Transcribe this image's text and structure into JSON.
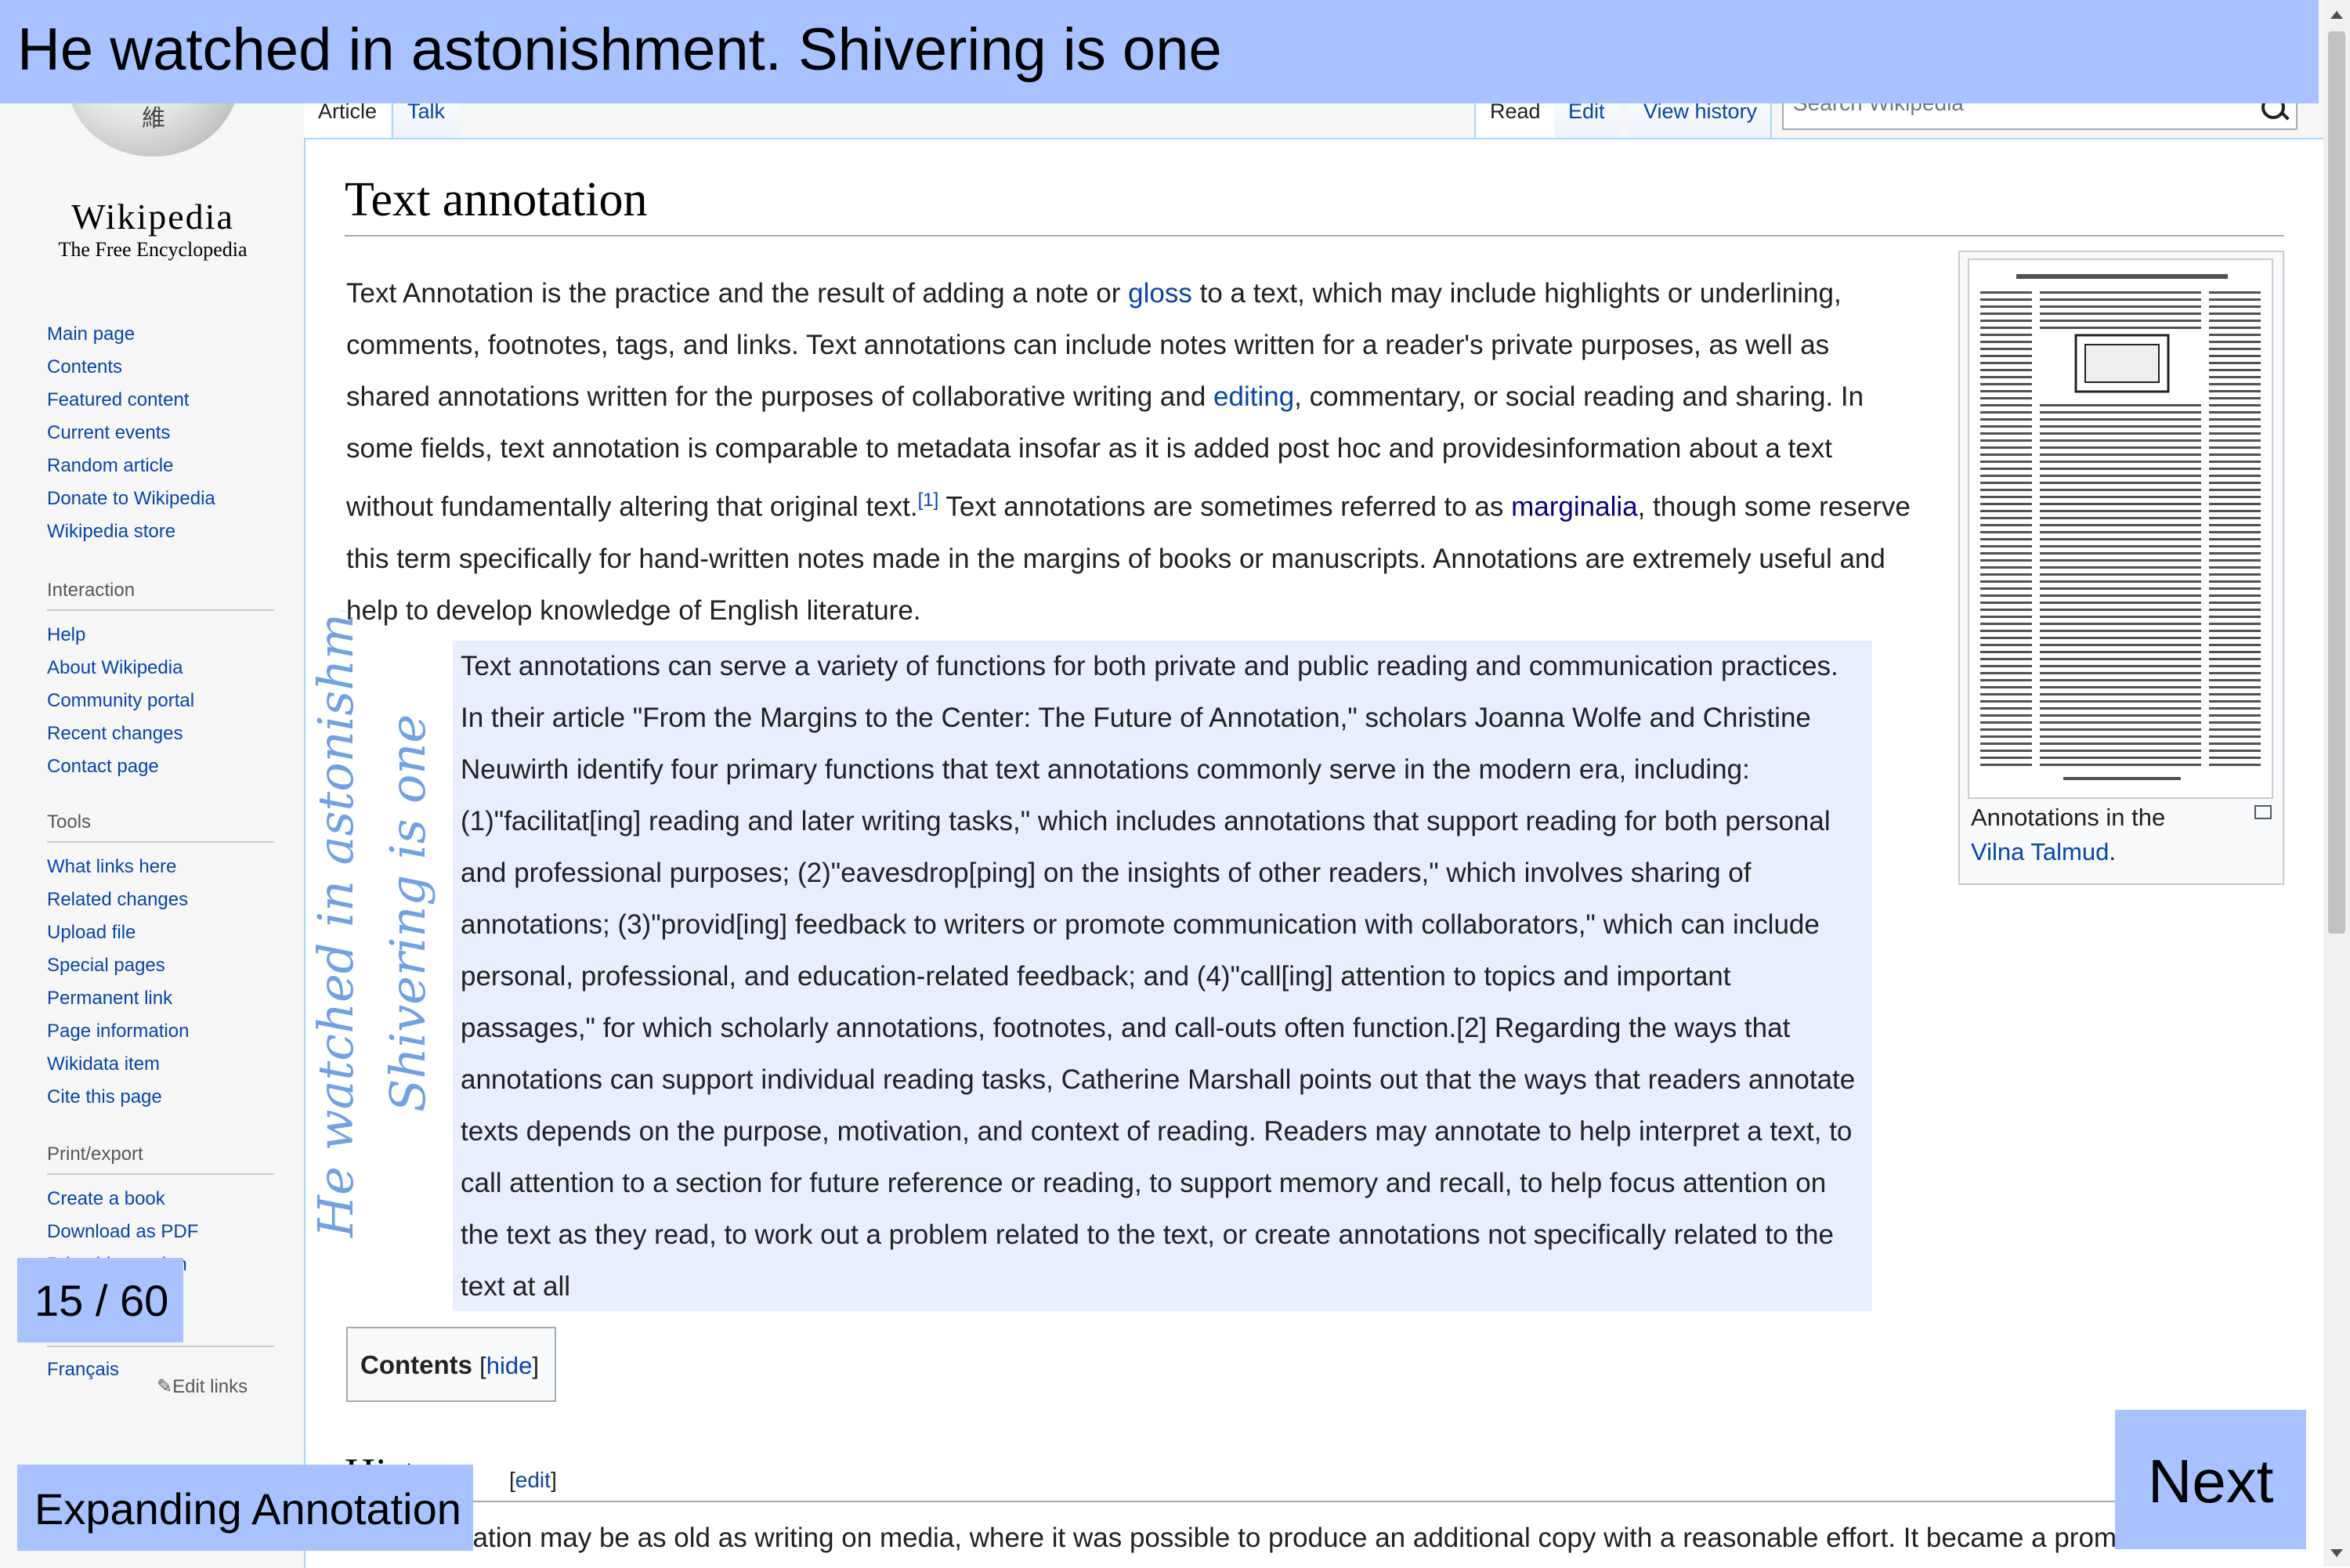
{
  "sidebar": {
    "wordmark": "Wikipedia",
    "tagline": "The Free Encyclopedia",
    "main_nav": [
      "Main page",
      "Contents",
      "Featured content",
      "Current events",
      "Random article",
      "Donate to Wikipedia",
      "Wikipedia store"
    ],
    "interaction": {
      "heading": "Interaction",
      "items": [
        "Help",
        "About Wikipedia",
        "Community portal",
        "Recent changes",
        "Contact page"
      ]
    },
    "tools": {
      "heading": "Tools",
      "items": [
        "What links here",
        "Related changes",
        "Upload file",
        "Special pages",
        "Permanent link",
        "Page information",
        "Wikidata item",
        "Cite this page"
      ]
    },
    "print": {
      "heading": "Print/export",
      "items": [
        "Create a book",
        "Download as PDF",
        "Printable version"
      ]
    },
    "languages": {
      "items": [
        "Français"
      ]
    },
    "edit_links": "Edit links"
  },
  "tabs": {
    "article": "Article",
    "talk": "Talk",
    "read": "Read",
    "edit": "Edit",
    "view_history": "View history"
  },
  "search": {
    "placeholder": "Search Wikipedia"
  },
  "article": {
    "title": "Text annotation",
    "p1_a": "Text Annotation is the practice and the result of adding a note or ",
    "link_gloss": "gloss",
    "p1_b": " to a text, which may include highlights or underlining, comments, footnotes, tags, and links. Text annotations can include notes written for a reader's private purposes, as well as shared annotations written for the purposes of collaborative writing and ",
    "link_editing": "editing",
    "p1_c": ", commentary, or social reading and sharing. In some fields, text annotation is comparable to metadata insofar as it is added post hoc and providesinformation about a text without fundamentally altering that original text.",
    "ref1": "[1]",
    "p1_d": " Text annotations are sometimes referred to as ",
    "link_marginalia": "marginalia",
    "p1_e": ", though some reserve this term specifically for hand-written notes made in the margins of books or manuscripts. Annotations are extremely useful and help to develop knowledge of English literature.",
    "quote": "Text annotations can serve a variety of functions for both private and public reading and communication practices. In their article \"From the Margins to the Center: The Future of Annotation,\" scholars Joanna Wolfe and Christine Neuwirth identify four primary functions that text annotations commonly serve in the modern era, including: (1)\"facilitat[ing] reading and later writing tasks,\" which includes annotations that support reading for both personal and professional purposes; (2)\"eavesdrop[ping] on the insights of other readers,\" which involves sharing of annotations; (3)\"provid[ing] feedback to writers or promote communication with collaborators,\" which can include personal, professional, and education-related feedback; and (4)\"call[ing] attention to topics and important passages,\" for which scholarly annotations, footnotes, and call-outs often function.[2] Regarding the ways that annotations can support individual reading tasks, Catherine Marshall points out that the ways that readers annotate texts depends on the purpose, motivation, and context of reading. Readers may annotate to help interpret a text, to call attention to a section for future reference or reading, to support memory and recall, to help focus attention on the text as they read, to work out a problem related to the text, or create annotations not specifically related to the text at all",
    "thumb_caption_a": "Annotations in the ",
    "thumb_caption_link": "Vilna Talmud",
    "thumb_caption_b": ".",
    "toc_title": "Contents",
    "toc_hide": "hide",
    "history_heading": "History",
    "history_edit": "edit",
    "history_text": "Text annotation may be as old as writing on media, where it was possible to produce an additional copy with a reasonable effort. It became a prominent"
  },
  "overlay": {
    "top_text": "He watched in astonishment. Shivering is one",
    "counter": "15 / 60",
    "mode": "Expanding Annotation",
    "next": "Next",
    "handwriting_lines": [
      "He watched in astonishment",
      "Shivering is one"
    ]
  },
  "colors": {
    "overlay": "#a8c1ff",
    "highlight": "#e8eefc",
    "link": "#0645ad",
    "ink": "#6fa0e8"
  }
}
